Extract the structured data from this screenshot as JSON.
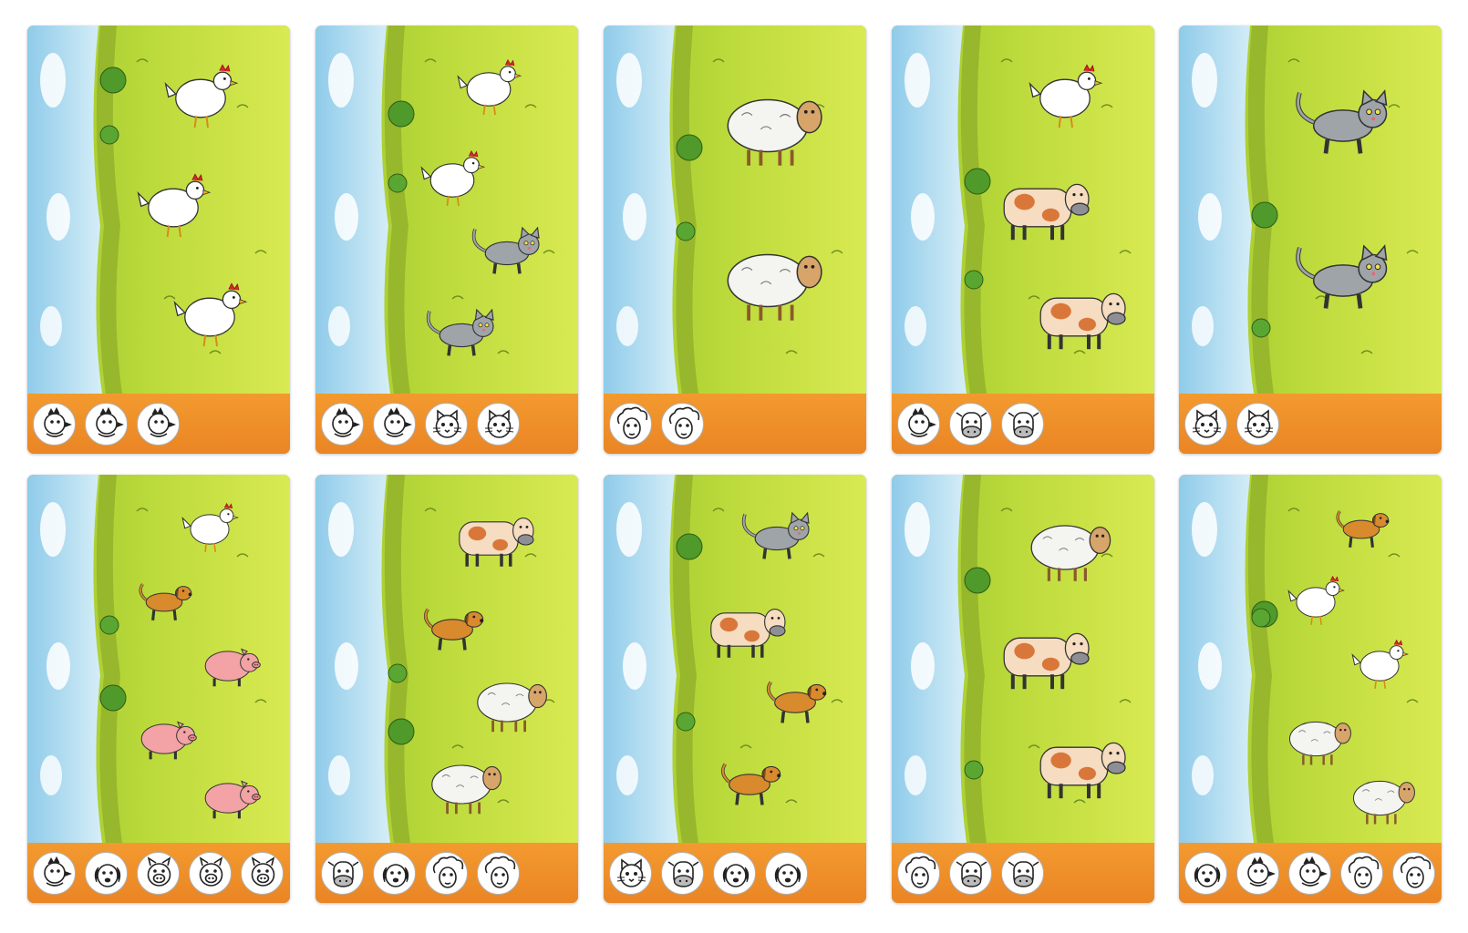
{
  "cards": [
    {
      "animals": [
        "hen",
        "hen",
        "hen"
      ],
      "icons": [
        "hen",
        "hen",
        "hen"
      ]
    },
    {
      "animals": [
        "hen",
        "hen",
        "cat",
        "cat"
      ],
      "icons": [
        "hen",
        "hen",
        "cat",
        "cat"
      ]
    },
    {
      "animals": [
        "sheep",
        "sheep"
      ],
      "icons": [
        "sheep",
        "sheep"
      ]
    },
    {
      "animals": [
        "hen",
        "cow",
        "cow"
      ],
      "icons": [
        "hen",
        "cow",
        "cow"
      ]
    },
    {
      "animals": [
        "cat",
        "cat"
      ],
      "icons": [
        "cat",
        "cat"
      ]
    },
    {
      "animals": [
        "hen",
        "dog",
        "pig",
        "pig",
        "pig"
      ],
      "icons": [
        "hen",
        "dog",
        "pig",
        "pig",
        "pig"
      ]
    },
    {
      "animals": [
        "cow",
        "dog",
        "sheep",
        "sheep"
      ],
      "icons": [
        "cow",
        "dog",
        "sheep",
        "sheep"
      ]
    },
    {
      "animals": [
        "cat",
        "cow",
        "dog",
        "dog"
      ],
      "icons": [
        "cat",
        "cow",
        "dog",
        "dog"
      ]
    },
    {
      "animals": [
        "sheep",
        "cow",
        "cow"
      ],
      "icons": [
        "sheep",
        "cow",
        "cow"
      ]
    },
    {
      "animals": [
        "dog",
        "hen",
        "hen",
        "sheep",
        "sheep"
      ],
      "icons": [
        "dog",
        "hen",
        "hen",
        "sheep",
        "sheep"
      ]
    }
  ],
  "colors": {
    "sky": "#bfe3f4",
    "grass": "#b8d93a",
    "strip": "#ef8f28",
    "hen": "#ffffff",
    "cat": "#9ea4a8",
    "sheep": "#f4f4f0",
    "cow": "#f6dcc0",
    "cow_spot": "#d9773a",
    "dog": "#d98a2c",
    "pig": "#f3a3a5"
  }
}
